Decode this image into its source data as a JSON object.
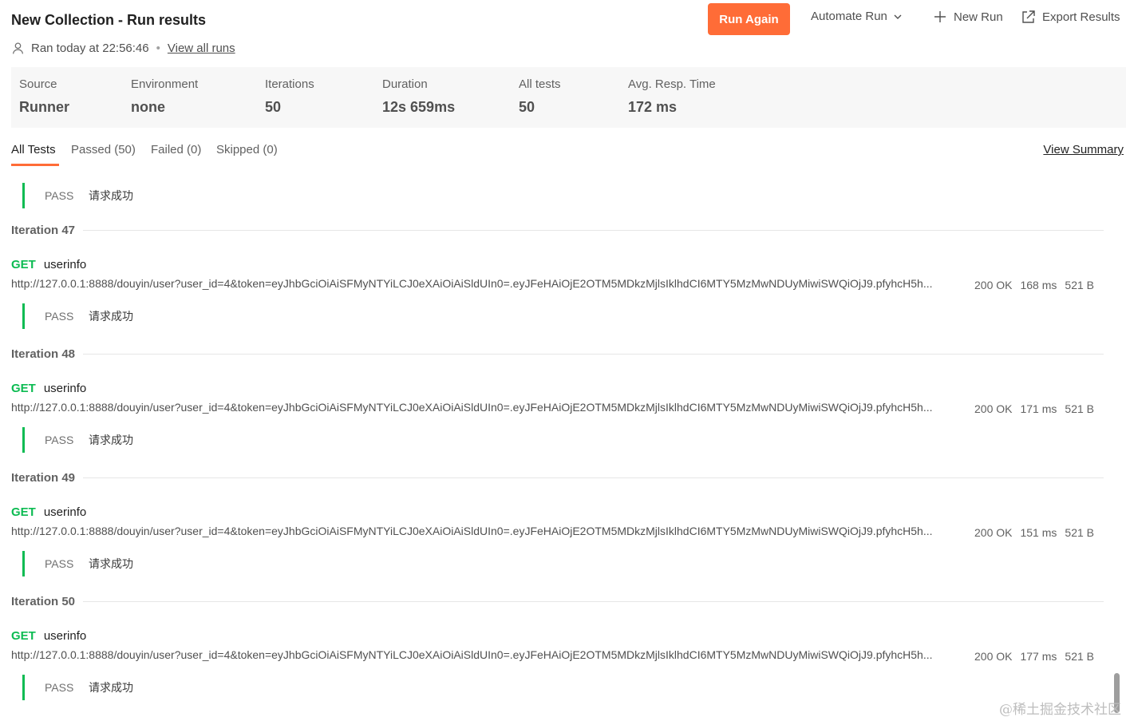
{
  "header": {
    "title": "New Collection - Run results",
    "ran_text": "Ran today at 22:56:46",
    "view_all_runs": "View all runs"
  },
  "actions": {
    "run_again": "Run Again",
    "automate_run": "Automate Run",
    "new_run": "New Run",
    "export_results": "Export Results"
  },
  "stats": [
    {
      "label": "Source",
      "value": "Runner"
    },
    {
      "label": "Environment",
      "value": "none"
    },
    {
      "label": "Iterations",
      "value": "50"
    },
    {
      "label": "Duration",
      "value": "12s 659ms"
    },
    {
      "label": "All tests",
      "value": "50"
    },
    {
      "label": "Avg. Resp. Time",
      "value": "172 ms"
    }
  ],
  "tabs": [
    "All Tests",
    "Passed (50)",
    "Failed (0)",
    "Skipped (0)"
  ],
  "view_summary": "View Summary",
  "results": {
    "top_pass": {
      "status": "PASS",
      "message": "请求成功"
    },
    "iterations": [
      {
        "label": "Iteration 47",
        "method": "GET",
        "name": "userinfo",
        "url": "http://127.0.0.1:8888/douyin/user?user_id=4&token=eyJhbGciOiAiSFMyNTYiLCJ0eXAiOiAiSldUIn0=.eyJFeHAiOjE2OTM5MDkzMjlsIklhdCI6MTY5MzMwNDUyMiwiSWQiOjJ9.pfyhcH5h...",
        "status": "200 OK",
        "time": "168 ms",
        "size": "521 B",
        "pass": "PASS",
        "message": "请求成功"
      },
      {
        "label": "Iteration 48",
        "method": "GET",
        "name": "userinfo",
        "url": "http://127.0.0.1:8888/douyin/user?user_id=4&token=eyJhbGciOiAiSFMyNTYiLCJ0eXAiOiAiSldUIn0=.eyJFeHAiOjE2OTM5MDkzMjlsIklhdCI6MTY5MzMwNDUyMiwiSWQiOjJ9.pfyhcH5h...",
        "status": "200 OK",
        "time": "171 ms",
        "size": "521 B",
        "pass": "PASS",
        "message": "请求成功"
      },
      {
        "label": "Iteration 49",
        "method": "GET",
        "name": "userinfo",
        "url": "http://127.0.0.1:8888/douyin/user?user_id=4&token=eyJhbGciOiAiSFMyNTYiLCJ0eXAiOiAiSldUIn0=.eyJFeHAiOjE2OTM5MDkzMjlsIklhdCI6MTY5MzMwNDUyMiwiSWQiOjJ9.pfyhcH5h...",
        "status": "200 OK",
        "time": "151 ms",
        "size": "521 B",
        "pass": "PASS",
        "message": "请求成功"
      },
      {
        "label": "Iteration 50",
        "method": "GET",
        "name": "userinfo",
        "url": "http://127.0.0.1:8888/douyin/user?user_id=4&token=eyJhbGciOiAiSFMyNTYiLCJ0eXAiOiAiSldUIn0=.eyJFeHAiOjE2OTM5MDkzMjlsIklhdCI6MTY5MzMwNDUyMiwiSWQiOjJ9.pfyhcH5h...",
        "status": "200 OK",
        "time": "177 ms",
        "size": "521 B",
        "pass": "PASS",
        "message": "请求成功"
      }
    ]
  },
  "watermark": "@稀土掘金技术社区",
  "colors": {
    "accent": "#ff6c37",
    "pass": "#0cbb52"
  }
}
